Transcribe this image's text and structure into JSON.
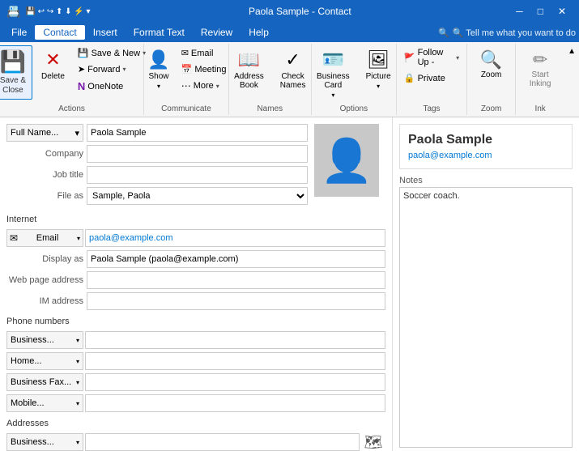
{
  "titlebar": {
    "title": "Paola Sample - Contact",
    "save_icon": "💾",
    "quickaccess": [
      "💾",
      "↩",
      "↪",
      "⬆",
      "⬇",
      "⚡",
      "▾"
    ],
    "minimize": "─",
    "maximize": "□",
    "close": "✕"
  },
  "menubar": {
    "items": [
      {
        "label": "File",
        "active": false
      },
      {
        "label": "Contact",
        "active": true
      },
      {
        "label": "Insert",
        "active": false
      },
      {
        "label": "Format Text",
        "active": false
      },
      {
        "label": "Review",
        "active": false
      },
      {
        "label": "Help",
        "active": false
      }
    ],
    "tell": "🔍  Tell me what you want to do"
  },
  "ribbon": {
    "groups": [
      {
        "name": "actions",
        "label": "Actions",
        "buttons": [
          {
            "id": "save-close",
            "icon": "💾",
            "label": "Save &\nClose",
            "large": true,
            "type": "save-close"
          },
          {
            "id": "delete",
            "icon": "✕",
            "label": "Delete",
            "large": true
          },
          {
            "id": "save-new",
            "icon": "💾",
            "label": "Save & New",
            "small": true,
            "dropdown": true
          },
          {
            "id": "forward",
            "icon": "➤",
            "label": "Forward",
            "small": true,
            "dropdown": true
          },
          {
            "id": "onenote",
            "icon": "N",
            "label": "OneNote",
            "small": true,
            "dropdown": false
          }
        ]
      },
      {
        "name": "communicate",
        "label": "Communicate",
        "buttons": [
          {
            "id": "show",
            "icon": "👤",
            "label": "Show",
            "large": true,
            "dropdown": true
          },
          {
            "id": "email",
            "icon": "✉",
            "label": "Email",
            "large": false,
            "small": true
          },
          {
            "id": "meeting",
            "icon": "📅",
            "label": "Meeting",
            "large": false,
            "small": true
          },
          {
            "id": "more",
            "icon": "...",
            "label": "More ▾",
            "small": true,
            "dropdown": true
          }
        ]
      },
      {
        "name": "names",
        "label": "Names",
        "buttons": [
          {
            "id": "address-book",
            "icon": "📖",
            "label": "Address\nBook",
            "large": true
          },
          {
            "id": "check-names",
            "icon": "✓",
            "label": "Check\nNames",
            "large": true
          }
        ]
      },
      {
        "name": "options",
        "label": "Options",
        "buttons": [
          {
            "id": "business-card",
            "icon": "🪪",
            "label": "Business\nCard",
            "large": true,
            "dropdown": true
          },
          {
            "id": "picture",
            "icon": "🖼",
            "label": "Picture",
            "large": true,
            "dropdown": true
          }
        ]
      },
      {
        "name": "tags",
        "label": "Tags",
        "buttons": [
          {
            "id": "follow-up",
            "icon": "🚩",
            "label": "Follow Up ▾",
            "small": true,
            "dropdown": true
          },
          {
            "id": "private",
            "icon": "🔒",
            "label": "Private",
            "small": true
          }
        ]
      },
      {
        "name": "zoom",
        "label": "Zoom",
        "buttons": [
          {
            "id": "zoom",
            "icon": "🔍",
            "label": "Zoom",
            "large": true
          }
        ]
      },
      {
        "name": "ink",
        "label": "Ink",
        "buttons": [
          {
            "id": "start-inking",
            "icon": "✏",
            "label": "Start\nInking",
            "large": true
          }
        ]
      }
    ]
  },
  "form": {
    "fields": {
      "full_name_label": "Full Name...",
      "full_name_value": "Paola Sample",
      "company_label": "Company",
      "company_value": "",
      "job_title_label": "Job title",
      "job_title_value": "",
      "file_as_label": "File as",
      "file_as_value": "Sample, Paola"
    },
    "internet": {
      "section_label": "Internet",
      "email_btn_label": "Email",
      "email_dropdown": "▾",
      "email_icon": "✉",
      "email_value": "paola@example.com",
      "display_as_label": "Display as",
      "display_as_value": "Paola Sample (paola@example.com)",
      "web_page_label": "Web page address",
      "web_page_value": "",
      "im_label": "IM address",
      "im_value": ""
    },
    "phone_numbers": {
      "section_label": "Phone numbers",
      "phones": [
        {
          "label": "Business...",
          "value": ""
        },
        {
          "label": "Home...",
          "value": ""
        },
        {
          "label": "Business Fax...",
          "value": ""
        },
        {
          "label": "Mobile...",
          "value": ""
        }
      ]
    },
    "addresses": {
      "section_label": "Addresses",
      "address_btn_label": "Business...",
      "address_value": ""
    }
  },
  "contact_card": {
    "name": "Paola Sample",
    "email": "paola@example.com"
  },
  "notes": {
    "label": "Notes",
    "content": "Soccer coach."
  },
  "colors": {
    "accent": "#1565c0",
    "link": "#0078d4"
  }
}
